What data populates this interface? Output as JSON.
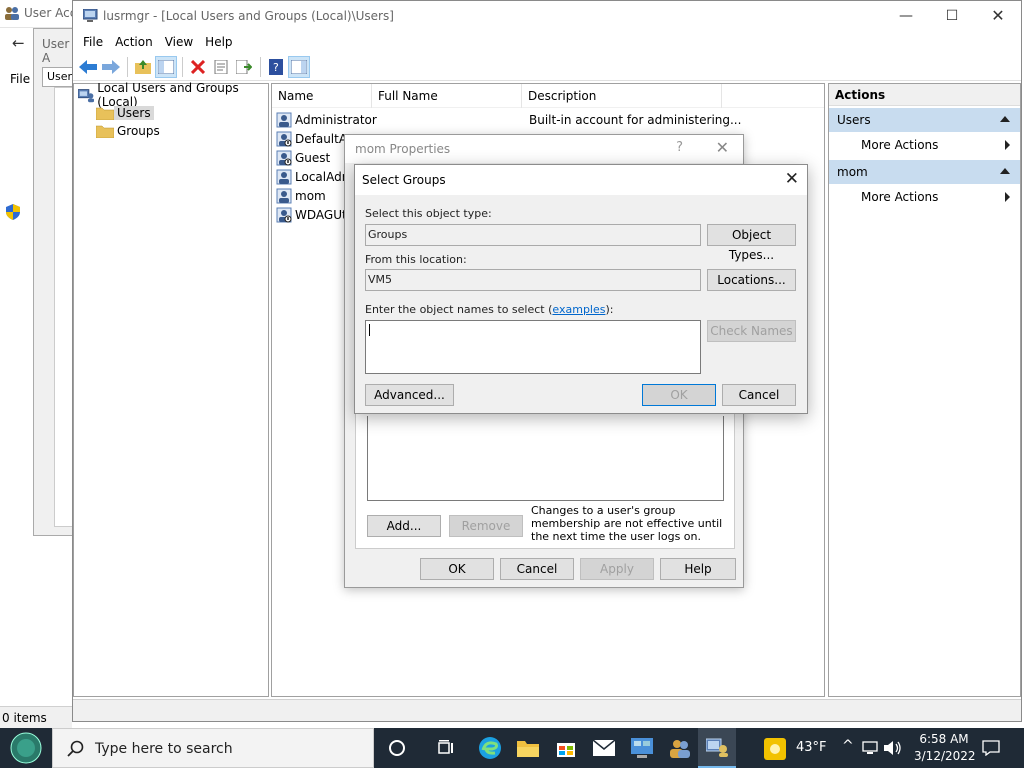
{
  "background": {
    "window1_title": "User Acc",
    "window1_menu_file": "File",
    "window2_title": "User A",
    "window2_tab": "Users",
    "status": "0 items"
  },
  "mmc": {
    "title": "lusrmgr - [Local Users and Groups (Local)\\Users]",
    "menu": [
      "File",
      "Action",
      "View",
      "Help"
    ],
    "tree": {
      "root": "Local Users and Groups (Local)",
      "children": [
        "Users",
        "Groups"
      ]
    },
    "list": {
      "columns": [
        "Name",
        "Full Name",
        "Description"
      ],
      "rows": [
        {
          "name": "Administrator",
          "description": "Built-in account for administering..."
        },
        {
          "name": "DefaultAc",
          "description": ""
        },
        {
          "name": "Guest",
          "description": ""
        },
        {
          "name": "LocalAdm",
          "description": ""
        },
        {
          "name": "mom",
          "description": ""
        },
        {
          "name": "WDAGUti",
          "description": ""
        }
      ]
    },
    "actions": {
      "header": "Actions",
      "sections": [
        {
          "title": "Users",
          "items": [
            "More Actions"
          ]
        },
        {
          "title": "mom",
          "items": [
            "More Actions"
          ]
        }
      ]
    }
  },
  "props_dialog": {
    "title": "mom Properties",
    "help": "?",
    "add_label": "Add...",
    "remove_label": "Remove",
    "note": "Changes to a user's group membership are not effective until the next time the user logs on.",
    "ok_label": "OK",
    "cancel_label": "Cancel",
    "apply_label": "Apply",
    "help_label": "Help"
  },
  "select_groups": {
    "title": "Select Groups",
    "object_type_label": "Select this object type:",
    "object_type_value": "Groups",
    "object_types_button": "Object Types...",
    "location_label": "From this location:",
    "location_value": "VM5",
    "locations_button": "Locations...",
    "names_label_prefix": "Enter the object names to select (",
    "names_label_link": "examples",
    "names_label_suffix": "):",
    "names_value": "",
    "check_names_button": "Check Names",
    "advanced_button": "Advanced...",
    "ok_button": "OK",
    "cancel_button": "Cancel"
  },
  "taskbar": {
    "search_placeholder": "Type here to search",
    "weather": "43°F",
    "time": "6:58 AM",
    "date": "3/12/2022"
  }
}
